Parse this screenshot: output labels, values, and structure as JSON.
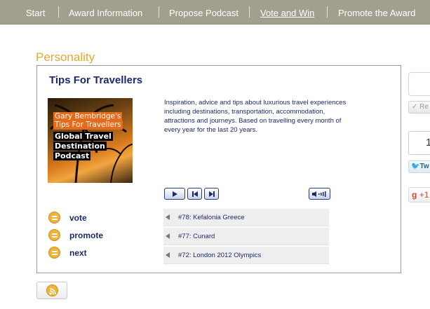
{
  "nav": {
    "items": [
      {
        "label": "Start"
      },
      {
        "label": "Award Information"
      },
      {
        "label": "Propose Podcast"
      },
      {
        "label": "Vote and Win"
      },
      {
        "label": "Promote the Award"
      }
    ]
  },
  "section": {
    "title": "Personality"
  },
  "podcast": {
    "title": "Tips For Travellers",
    "cover": {
      "line1": "Gary Bembridge's",
      "line2": "Tips For Travellers",
      "line3": "Global Travel",
      "line4": "Destination",
      "line5": "Podcast"
    },
    "description": "Inspiration, advice and tips about luxurious travel experiences including destinations, transportation, accommodation, attractions and journeys. Based on travelling every month of every year for the last 20 years.",
    "actions": [
      {
        "label": "vote"
      },
      {
        "label": "promote"
      },
      {
        "label": "next"
      }
    ],
    "episodes": [
      {
        "title": "#78: Kefalonia Greece"
      },
      {
        "title": "#77: Cunard"
      },
      {
        "title": "#72: London 2012 Olympics"
      }
    ]
  },
  "social": {
    "recommend_label": "Re",
    "count": "1",
    "tweet_label": "Tw",
    "gplus_label": "+1"
  },
  "colors": {
    "nav_bg": "#a39f8e",
    "accent": "#e8a530",
    "title": "#1c2a6b"
  }
}
